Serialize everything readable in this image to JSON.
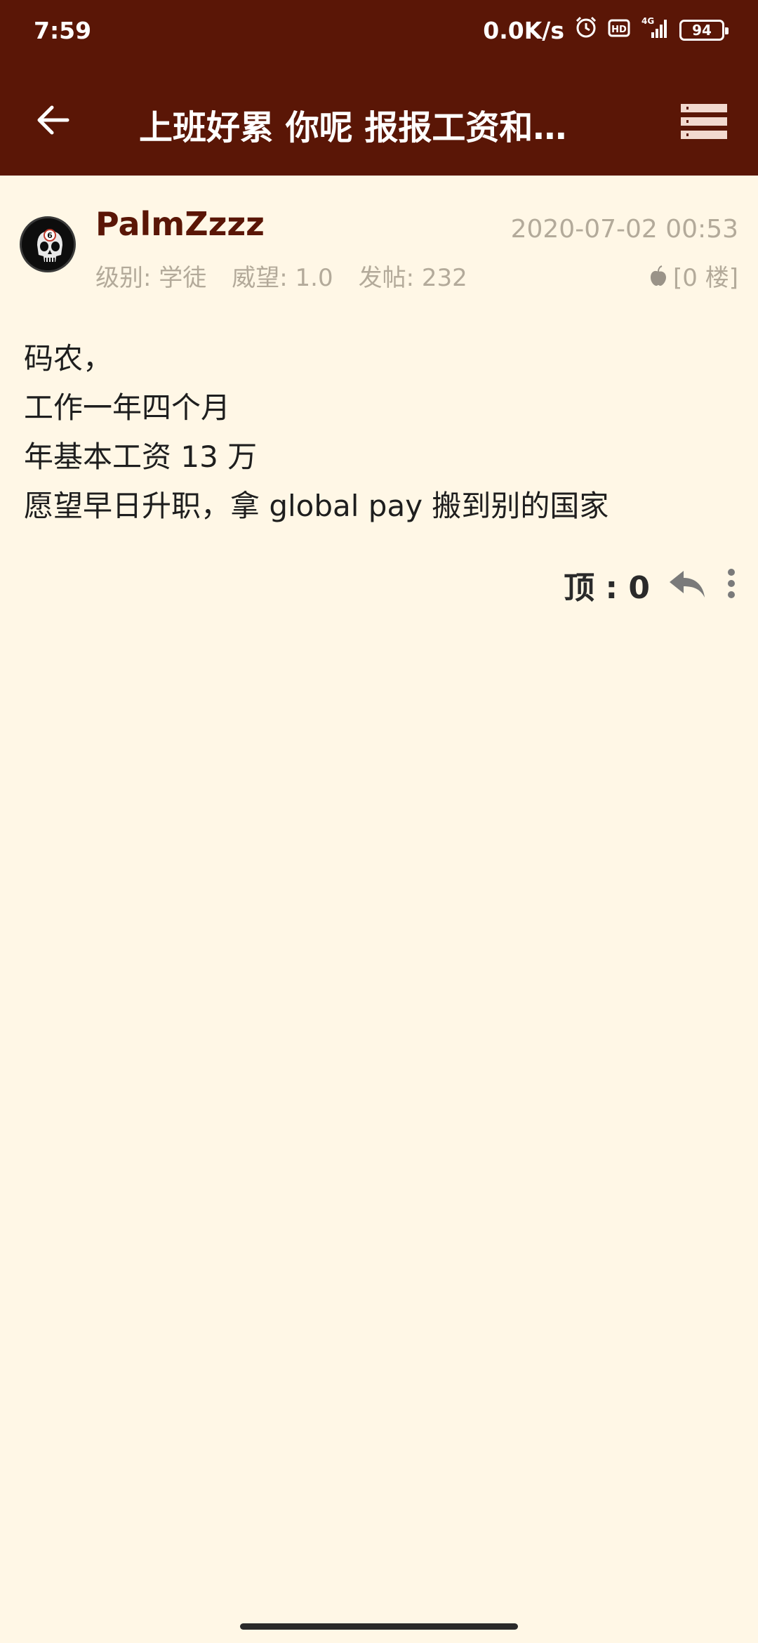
{
  "status_bar": {
    "time": "7:59",
    "net_speed": "0.0K/s",
    "battery": "94",
    "signal": "4G",
    "hd": "HD"
  },
  "toolbar": {
    "title": "上班好累 你呢 报报工资和…"
  },
  "post": {
    "author": "PalmZzzz",
    "avatar_badge": "6",
    "date": "2020-07-02 00:53",
    "meta": {
      "level": "级别: 学徒",
      "prestige": "威望: 1.0",
      "posts": "发帖: 232"
    },
    "floor": "[0 楼]",
    "content_lines": [
      "码农，",
      "工作一年四个月",
      "年基本工资 13 万",
      "愿望早日升职，拿 global pay 搬到别的国家"
    ],
    "upvote_label": "顶 : 0"
  },
  "colors": {
    "appbar": "#5a1606",
    "background": "#fff7e6",
    "author": "#5a1606",
    "meta": "#b3aa9a"
  }
}
